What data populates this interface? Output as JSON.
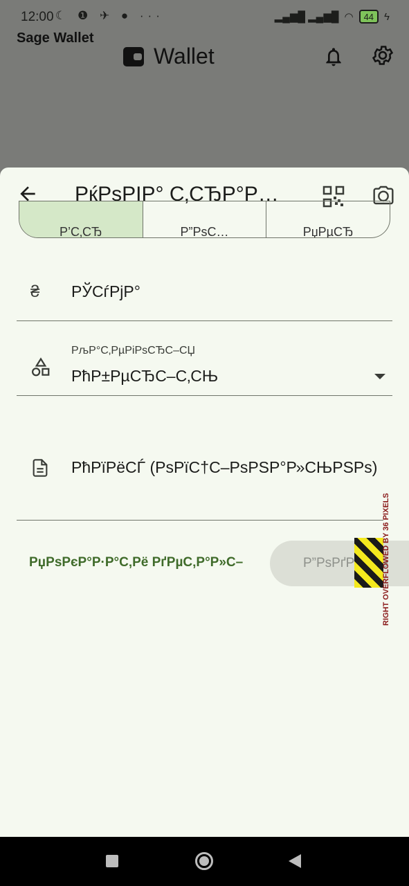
{
  "status_bar": {
    "time": "12:00",
    "left_icons": "☾ ❶ ✈ ● ···",
    "signal": "▂▄▆█ ▂▄▆█",
    "wifi": "◠",
    "battery": "44",
    "charging": "ϟ"
  },
  "app": {
    "name": "Sage Wallet",
    "title": "Wallet"
  },
  "sheet": {
    "title": "РќРѕРІР° С‚СЂР°РЅР·Р°РєС†С–СЏ",
    "segments": [
      {
        "label": "Р’С‚СЂ",
        "selected": true
      },
      {
        "label": "Р”РѕС…",
        "selected": false
      },
      {
        "label": "РџРµСЂ",
        "selected": false
      }
    ],
    "amount_currency": "₴",
    "amount_placeholder": "РЎСѓРјР°",
    "category_label": "РљР°С‚РµРіРѕСЂС–СЏ",
    "category_value": "РћР±РµСЂС–С‚СЊ",
    "description_placeholder": "РћРїРёСЃ (РѕРїС†С–РѕРЅР°Р»СЊРЅРѕ)",
    "cancel_label": "РџРѕРєР°Р·Р°С‚Рё РґРµС‚Р°Р»С–",
    "submit_label": "Р”РѕРґР°С‚Рё",
    "overflow_warning": "RIGHT OVERFLOWED BY 36 PIXELS"
  },
  "colors": {
    "accent": "#3f6b2a",
    "segment_selected": "#d5e8c8",
    "sheet_background": "#f5f9f0",
    "scrim": "#7a7b78"
  }
}
